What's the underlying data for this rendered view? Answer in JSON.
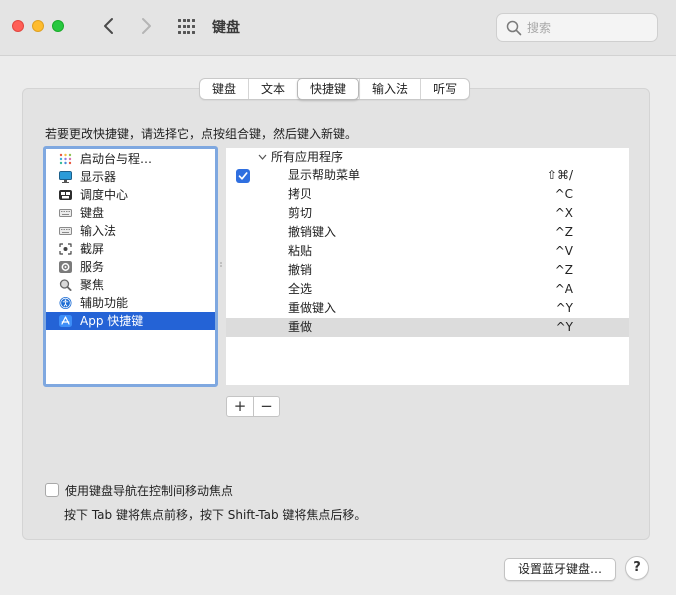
{
  "window": {
    "title": "键盘",
    "search_placeholder": "搜索"
  },
  "tabs": [
    {
      "label": "键盘",
      "active": false
    },
    {
      "label": "文本",
      "active": false
    },
    {
      "label": "快捷键",
      "active": true
    },
    {
      "label": "输入法",
      "active": false
    },
    {
      "label": "听写",
      "active": false
    }
  ],
  "instruction": "若要更改快捷键，请选择它，点按组合键，然后键入新键。",
  "categories": [
    {
      "label": "启动台与程…",
      "icon": "launchpad-icon"
    },
    {
      "label": "显示器",
      "icon": "display-icon"
    },
    {
      "label": "调度中心",
      "icon": "mission-control-icon"
    },
    {
      "label": "键盘",
      "icon": "keyboard-icon"
    },
    {
      "label": "输入法",
      "icon": "input-source-icon"
    },
    {
      "label": "截屏",
      "icon": "screenshot-icon"
    },
    {
      "label": "服务",
      "icon": "services-icon"
    },
    {
      "label": "聚焦",
      "icon": "spotlight-icon"
    },
    {
      "label": "辅助功能",
      "icon": "accessibility-icon"
    },
    {
      "label": "App 快捷键",
      "icon": "app-store-icon",
      "selected": true
    }
  ],
  "shortcuts": {
    "group_label": "所有应用程序",
    "items": [
      {
        "label": "显示帮助菜单",
        "key": "⇧⌘/",
        "checked": true
      },
      {
        "label": "拷贝",
        "key": "^C"
      },
      {
        "label": "剪切",
        "key": "^X"
      },
      {
        "label": "撤销键入",
        "key": "^Z"
      },
      {
        "label": "粘贴",
        "key": "^V"
      },
      {
        "label": "撤销",
        "key": "^Z"
      },
      {
        "label": "全选",
        "key": "^A"
      },
      {
        "label": "重做键入",
        "key": "^Y"
      },
      {
        "label": "重做",
        "key": "^Y",
        "selected": true
      }
    ]
  },
  "buttons": {
    "add": "+",
    "remove": "−",
    "bluetooth": "设置蓝牙键盘…",
    "help": "?"
  },
  "keyboard_nav": {
    "label": "使用键盘导航在控制间移动焦点",
    "checked": false,
    "hint": "按下 Tab 键将焦点前移，按下 Shift-Tab 键将焦点后移。"
  },
  "colors": {
    "accent": "#2463d6",
    "checkbox": "#2f6fe0",
    "selection_inactive": "#dcdcdc"
  }
}
